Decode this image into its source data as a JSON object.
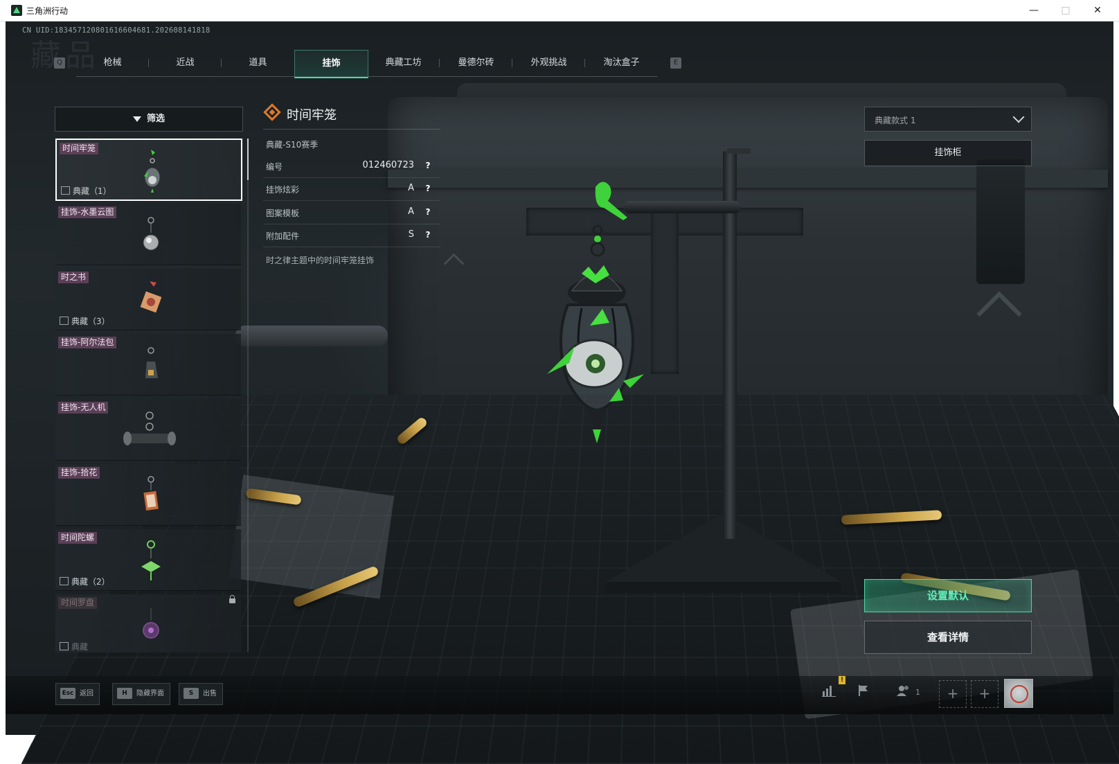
{
  "window": {
    "title": "三角洲行动",
    "min_icon": "minimize-icon",
    "max_icon": "maximize-icon",
    "close_icon": "close-icon"
  },
  "header": {
    "uid": "CN UID:183457120801616604681.202608141818",
    "bg_title": "藏品"
  },
  "tabs": {
    "left_key": "Q",
    "right_key": "E",
    "items": [
      {
        "label": "枪械"
      },
      {
        "label": "近战"
      },
      {
        "label": "道具"
      },
      {
        "label": "挂饰"
      },
      {
        "label": "典藏工坊"
      },
      {
        "label": "曼德尔砖"
      },
      {
        "label": "外观挑战"
      },
      {
        "label": "淘汰盒子"
      }
    ],
    "active_index": 3
  },
  "filter": {
    "label": "筛选",
    "icon": "filter-icon"
  },
  "list": {
    "items": [
      {
        "name": "时间牢笼",
        "count": "典藏（1）",
        "selected": true,
        "locked": false
      },
      {
        "name": "挂饰-水墨云图",
        "count": "",
        "selected": false,
        "locked": false
      },
      {
        "name": "时之书",
        "count": "典藏（3）",
        "selected": false,
        "locked": false
      },
      {
        "name": "挂饰-阿尔法包",
        "count": "",
        "selected": false,
        "locked": false
      },
      {
        "name": "挂饰-无人机",
        "count": "",
        "selected": false,
        "locked": false
      },
      {
        "name": "挂饰-拾花",
        "count": "",
        "selected": false,
        "locked": false
      },
      {
        "name": "时间陀螺",
        "count": "典藏（2）",
        "selected": false,
        "locked": false
      },
      {
        "name": "时间罗盘",
        "count": "典藏",
        "selected": false,
        "locked": true
      }
    ]
  },
  "detail": {
    "title": "时间牢笼",
    "season": "典藏-S10赛季",
    "attributes": [
      {
        "label": "编号",
        "value": "012460723",
        "help": "?"
      },
      {
        "label": "挂饰炫彩",
        "value": "A",
        "help": "?"
      },
      {
        "label": "图案模板",
        "value": "A",
        "help": "?"
      },
      {
        "label": "附加配件",
        "value": "S",
        "help": "?"
      }
    ],
    "description": "时之律主题中的时间牢笼挂饰"
  },
  "right": {
    "style_select": "典藏款式 1",
    "cabinet_button": "挂饰柜",
    "set_default_button": "设置默认",
    "view_details_button": "查看详情"
  },
  "bottom": {
    "hints": [
      {
        "key": "Esc",
        "label": "返回"
      },
      {
        "key": "H",
        "label": "隐藏界面"
      },
      {
        "key": "S",
        "label": "出售"
      }
    ],
    "notification": "!",
    "friend_count": "1",
    "plus": "+",
    "status_icons": [
      "stats-icon",
      "flag-icon",
      "friends-icon"
    ]
  },
  "colors": {
    "accent_green": "#4fd6a5",
    "tag_purple": "#5b3f57",
    "title_icon_orange": "#e07a2a"
  }
}
